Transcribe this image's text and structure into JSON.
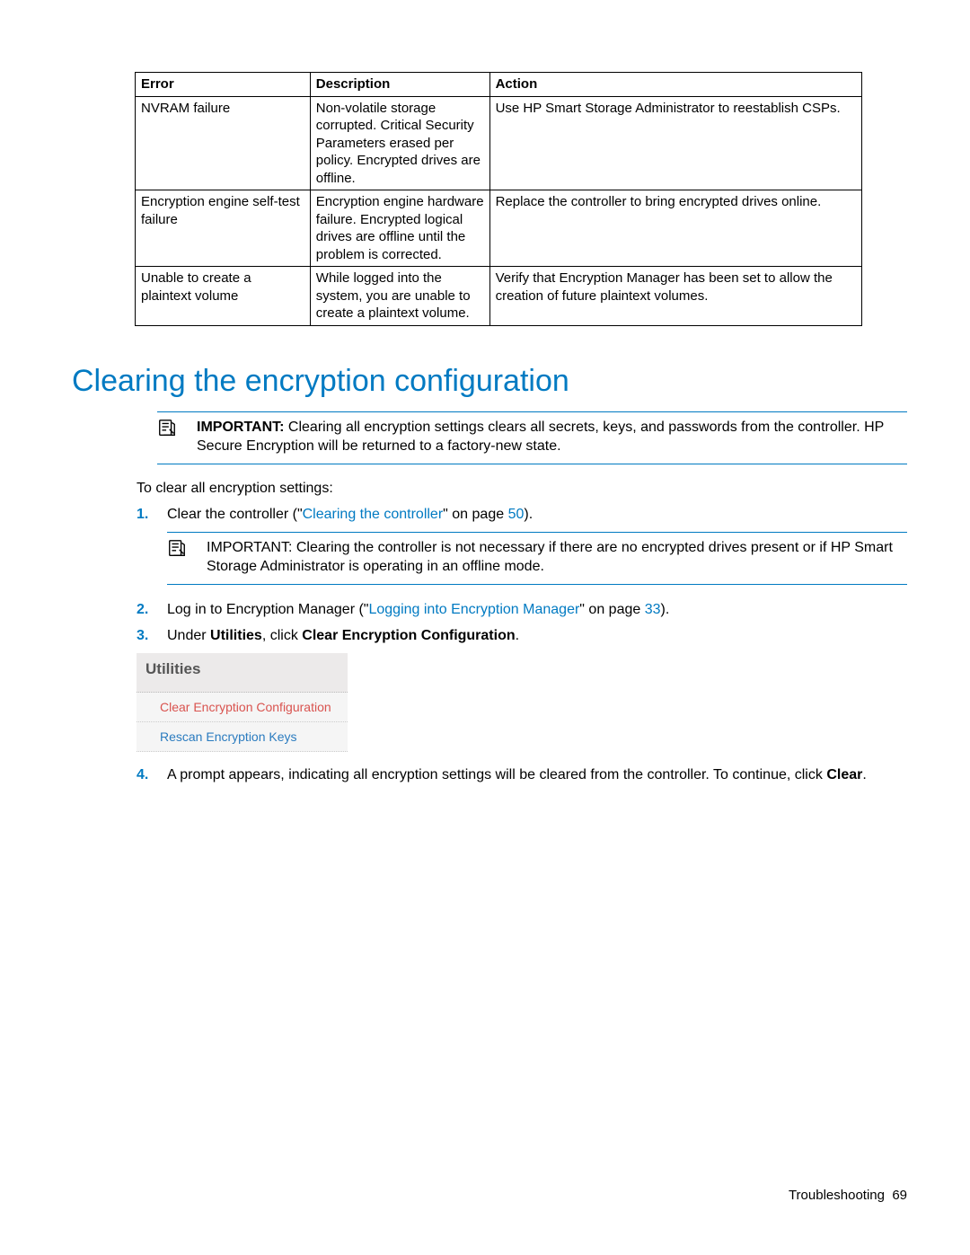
{
  "table": {
    "headers": [
      "Error",
      "Description",
      "Action"
    ],
    "rows": [
      {
        "error": "NVRAM failure",
        "desc": "Non-volatile storage corrupted. Critical Security Parameters erased per policy. Encrypted drives are offline.",
        "action": "Use HP Smart Storage Administrator to reestablish CSPs."
      },
      {
        "error": "Encryption engine self-test failure",
        "desc": "Encryption engine hardware failure. Encrypted logical drives are offline until the problem is corrected.",
        "action": "Replace the controller to bring encrypted drives online."
      },
      {
        "error": "Unable to create a plaintext volume",
        "desc": "While logged into the system, you are unable to create a plaintext volume.",
        "action": "Verify that Encryption Manager has been set to allow the creation of future plaintext volumes."
      }
    ]
  },
  "section_heading": "Clearing the encryption configuration",
  "important1": {
    "label": "IMPORTANT:",
    "text": "Clearing all encryption settings clears all secrets, keys, and passwords from the controller. HP Secure Encryption will be returned to a factory-new state."
  },
  "intro": "To clear all encryption settings:",
  "steps": {
    "s1": {
      "num": "1.",
      "pre": "Clear the controller (\"",
      "link": "Clearing the controller",
      "mid": "\" on page ",
      "page": "50",
      "post": ")."
    },
    "s1_important": {
      "label": "IMPORTANT:",
      "text": "Clearing the controller is not necessary if there are no encrypted drives present or if HP Smart Storage Administrator is operating in an offline mode."
    },
    "s2": {
      "num": "2.",
      "pre": "Log in to Encryption Manager (\"",
      "link": "Logging into Encryption Manager",
      "mid": "\" on page ",
      "page": "33",
      "post": ")."
    },
    "s3": {
      "num": "3.",
      "pre": "Under ",
      "bold1": "Utilities",
      "mid": ", click ",
      "bold2": "Clear Encryption Configuration",
      "post": "."
    },
    "s4": {
      "num": "4.",
      "pre": "A prompt appears, indicating all encryption settings will be cleared from the controller. To continue, click ",
      "bold": "Clear",
      "post": "."
    }
  },
  "utilities_panel": {
    "title": "Utilities",
    "item1": "Clear Encryption Configuration",
    "item2": "Rescan Encryption Keys"
  },
  "footer": {
    "section": "Troubleshooting",
    "page": "69"
  }
}
